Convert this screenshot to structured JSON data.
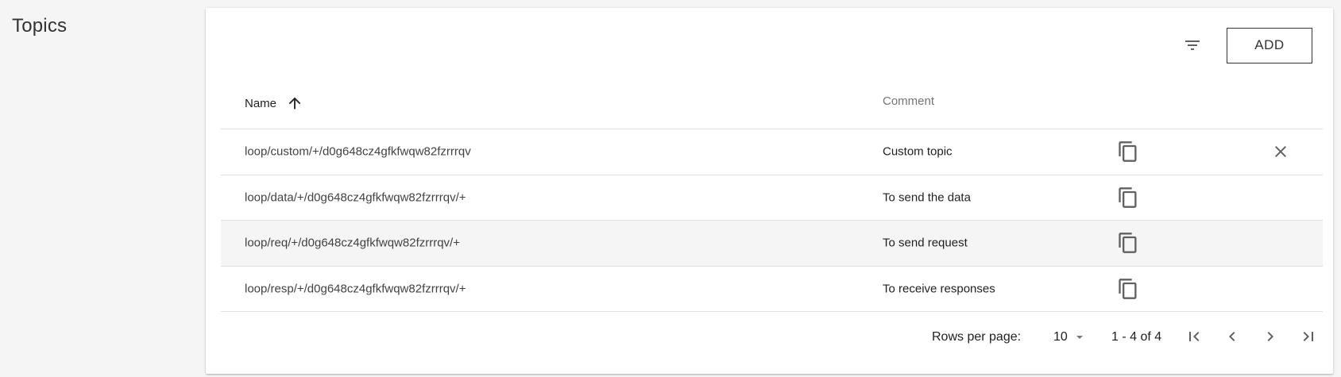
{
  "page": {
    "title": "Topics"
  },
  "toolbar": {
    "add_label": "ADD",
    "filter_icon": "filter-icon"
  },
  "table": {
    "columns": {
      "name": "Name",
      "comment": "Comment"
    },
    "sort": {
      "column": "Name",
      "direction": "ascending"
    },
    "rows": [
      {
        "name": "loop/custom/+/d0g648cz4gfkfwqw82fzrrrqv",
        "comment": "Custom topic",
        "deletable": true
      },
      {
        "name": "loop/data/+/d0g648cz4gfkfwqw82fzrrrqv/+",
        "comment": "To send the data",
        "deletable": false
      },
      {
        "name": "loop/req/+/d0g648cz4gfkfwqw82fzrrrqv/+",
        "comment": "To send request",
        "deletable": false
      },
      {
        "name": "loop/resp/+/d0g648cz4gfkfwqw82fzrrrqv/+",
        "comment": "To receive responses",
        "deletable": false
      }
    ]
  },
  "pagination": {
    "rows_per_page_label": "Rows per page:",
    "rows_per_page_value": "10",
    "range_label": "1 - 4 of 4"
  },
  "colors": {
    "text": "#212121",
    "muted": "#757575",
    "divider": "#e0e0e0",
    "hover_row": "#f5f5f5"
  }
}
